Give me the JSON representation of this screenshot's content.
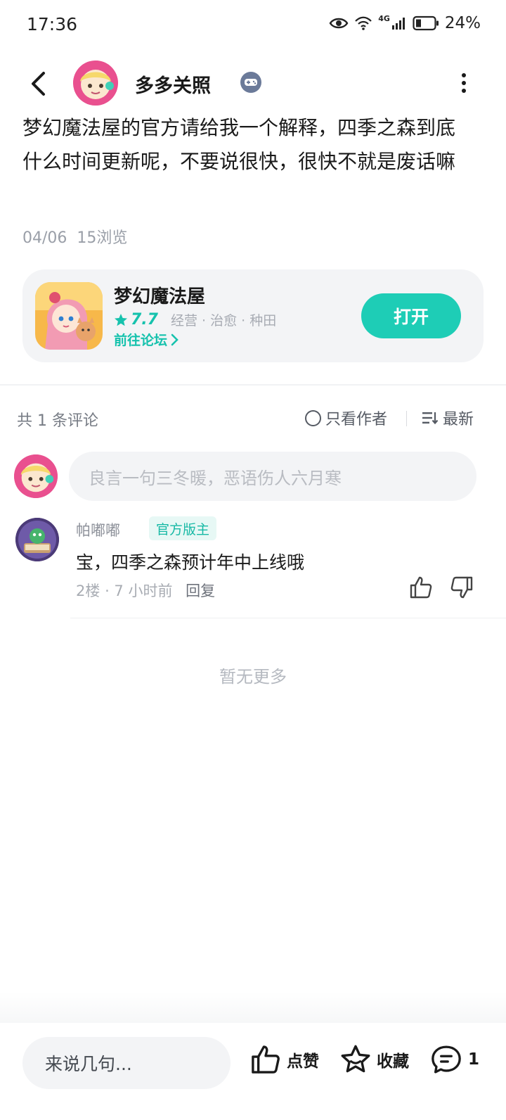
{
  "status_bar": {
    "time": "17:36",
    "network": "4G",
    "battery": "24%"
  },
  "header": {
    "author_name": "多多关照",
    "icons": [
      "back-icon",
      "gamepad-icon",
      "more-icon"
    ]
  },
  "post": {
    "text": "梦幻魔法屋的官方请给我一个解释，四季之森到底什么时间更新呢，不要说很快，很快不就是废话嘛",
    "date": "04/06",
    "views": "15浏览"
  },
  "game_card": {
    "name": "梦幻魔法屋",
    "rating": "7.7",
    "tags": "经营 · 治愈 · 种田",
    "forum_link": "前往论坛",
    "open_button": "打开",
    "accent_color": "#1ecdb6"
  },
  "comments_section": {
    "count_label": "共 1 条评论",
    "only_author": "只看作者",
    "sort": "最新",
    "input_placeholder": "良言一句三冬暖，恶语伤人六月寒",
    "comments": [
      {
        "name": "帕嘟嘟",
        "badge": "官方版主",
        "text": "宝，四季之森预计年中上线哦",
        "floor": "2楼",
        "time": "7 小时前",
        "reply": "回复"
      }
    ],
    "end_text": "暂无更多"
  },
  "bottom_bar": {
    "input_placeholder": "来说几句...",
    "like": "点赞",
    "favorite": "收藏",
    "comment_count": "1"
  }
}
